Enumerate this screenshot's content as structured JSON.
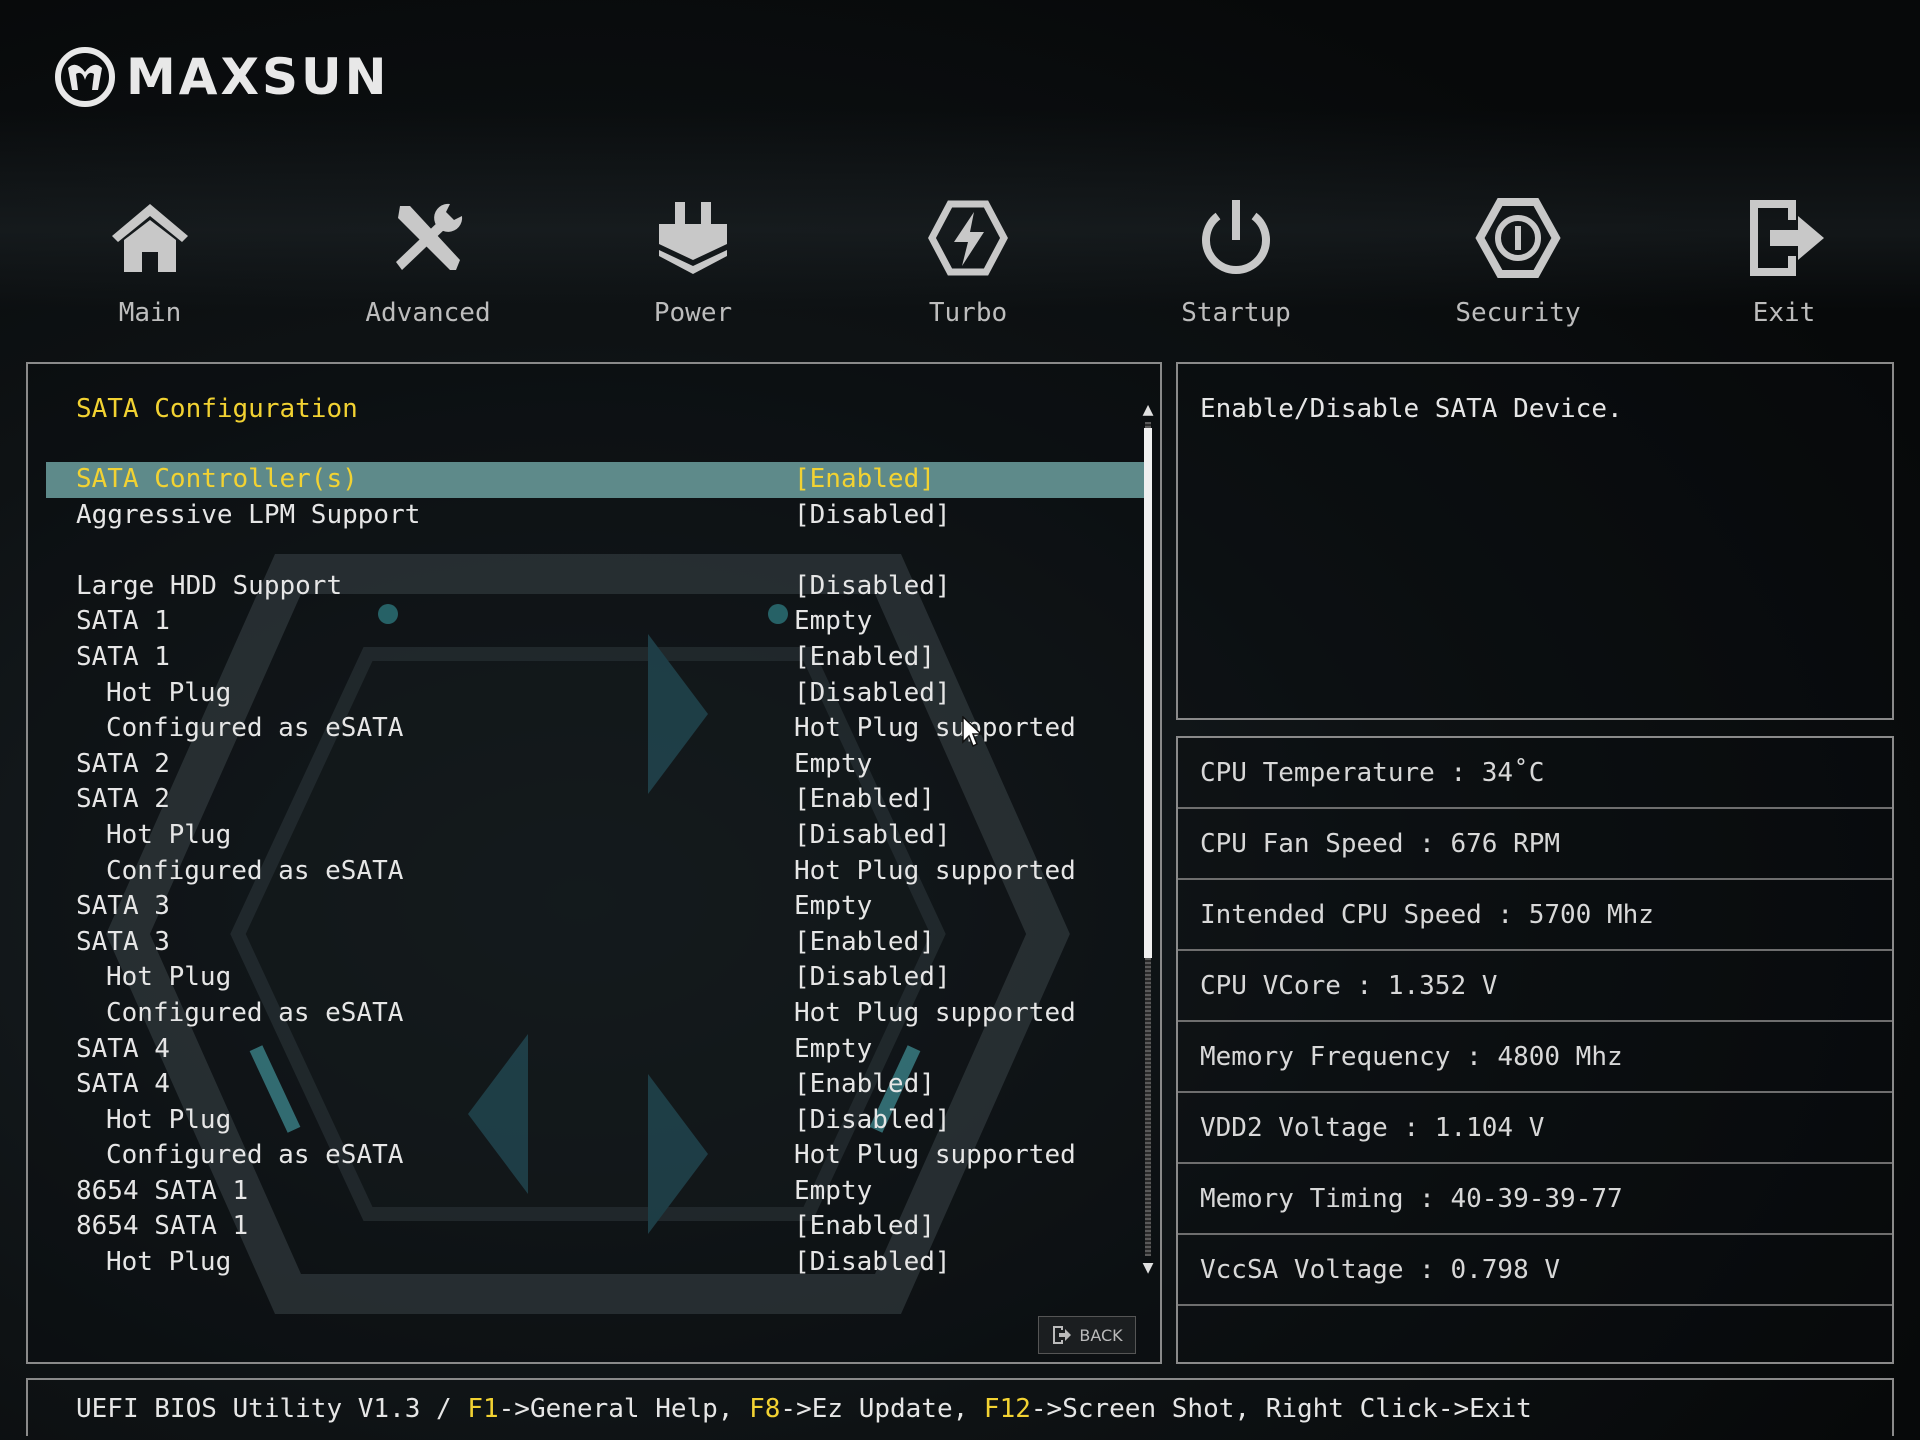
{
  "brand": {
    "name": "MAXSUN"
  },
  "nav": [
    {
      "label": "Main",
      "icon": "home-icon"
    },
    {
      "label": "Advanced",
      "icon": "tools-icon"
    },
    {
      "label": "Power",
      "icon": "power-plug-icon"
    },
    {
      "label": "Turbo",
      "icon": "turbo-icon"
    },
    {
      "label": "Startup",
      "icon": "startup-icon"
    },
    {
      "label": "Security",
      "icon": "security-icon"
    },
    {
      "label": "Exit",
      "icon": "exit-icon"
    }
  ],
  "main": {
    "section_title": "SATA Configuration",
    "rows": [
      {
        "label": "SATA Controller(s)",
        "value": "[Enabled]",
        "selected": true,
        "sub": false
      },
      {
        "label": "Aggressive LPM Support",
        "value": "[Disabled]",
        "sub": false
      },
      {
        "spacer": true
      },
      {
        "label": "Large HDD Support",
        "value": "[Disabled]",
        "sub": false
      },
      {
        "label": "SATA 1",
        "value": "Empty",
        "sub": false
      },
      {
        "label": "SATA 1",
        "value": "[Enabled]",
        "sub": false
      },
      {
        "label": "Hot Plug",
        "value": "[Disabled]",
        "sub": true
      },
      {
        "label": "Configured as eSATA",
        "value": "Hot Plug supported",
        "sub": true
      },
      {
        "label": "SATA 2",
        "value": "Empty",
        "sub": false
      },
      {
        "label": "SATA 2",
        "value": "[Enabled]",
        "sub": false
      },
      {
        "label": "Hot Plug",
        "value": "[Disabled]",
        "sub": true
      },
      {
        "label": "Configured as eSATA",
        "value": "Hot Plug supported",
        "sub": true
      },
      {
        "label": "SATA 3",
        "value": "Empty",
        "sub": false
      },
      {
        "label": "SATA 3",
        "value": "[Enabled]",
        "sub": false
      },
      {
        "label": "Hot Plug",
        "value": "[Disabled]",
        "sub": true
      },
      {
        "label": "Configured as eSATA",
        "value": "Hot Plug supported",
        "sub": true
      },
      {
        "label": "SATA 4",
        "value": "Empty",
        "sub": false
      },
      {
        "label": "SATA 4",
        "value": "[Enabled]",
        "sub": false
      },
      {
        "label": "Hot Plug",
        "value": "[Disabled]",
        "sub": true
      },
      {
        "label": "Configured as eSATA",
        "value": "Hot Plug supported",
        "sub": true
      },
      {
        "label": "8654 SATA 1",
        "value": "Empty",
        "sub": false
      },
      {
        "label": "8654 SATA 1",
        "value": "[Enabled]",
        "sub": false
      },
      {
        "label": "Hot Plug",
        "value": "[Disabled]",
        "sub": true
      }
    ],
    "scroll": {
      "up": "▲",
      "down": "▼"
    },
    "back_label": "BACK"
  },
  "help": {
    "text": "Enable/Disable SATA Device."
  },
  "info": [
    "CPU Temperature : 34˚C",
    "CPU Fan Speed : 676 RPM",
    "Intended CPU Speed : 5700 Mhz",
    "CPU VCore : 1.352 V",
    "Memory Frequency : 4800 Mhz",
    "VDD2 Voltage : 1.104 V",
    "Memory Timing : 40-39-39-77",
    "VccSA Voltage : 0.798 V"
  ],
  "footer": {
    "prefix": "UEFI BIOS Utility V1.3 / ",
    "keys": [
      {
        "key": "F1",
        "action": "->General Help, "
      },
      {
        "key": "F8",
        "action": "->Ez Update, "
      },
      {
        "key": "F12",
        "action": "->Screen Shot, Right Click->Exit"
      }
    ]
  },
  "colors": {
    "highlight_bg": "#5e8a8a",
    "highlight_text": "#f2d232",
    "border": "#8a8a8a"
  }
}
